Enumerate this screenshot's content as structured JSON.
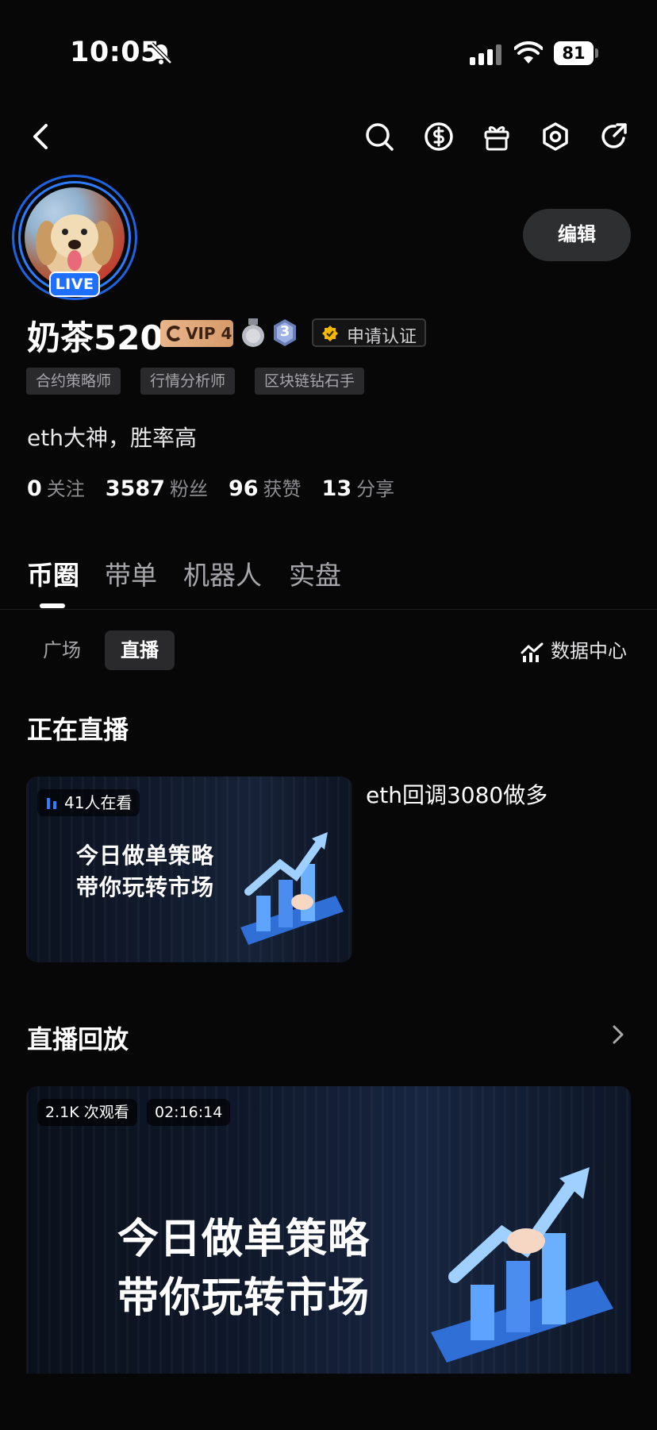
{
  "status_bar": {
    "time": "10:05",
    "battery": "81"
  },
  "profile": {
    "live_badge": "LIVE",
    "edit_label": "编辑",
    "name": "奶茶520",
    "vip_label": "VIP 4",
    "level": "3",
    "certify_label": "申请认证",
    "tags": [
      "合约策略师",
      "行情分析师",
      "区块链钻石手"
    ],
    "bio": "eth大神，胜率高",
    "stats": [
      {
        "value": "0",
        "label": "关注"
      },
      {
        "value": "3587",
        "label": "粉丝"
      },
      {
        "value": "96",
        "label": "获赞"
      },
      {
        "value": "13",
        "label": "分享"
      }
    ]
  },
  "tabs": [
    "币圈",
    "带单",
    "机器人",
    "实盘"
  ],
  "subtabs": [
    "广场",
    "直播"
  ],
  "data_center_label": "数据中心",
  "live_section": {
    "title": "正在直播",
    "viewers": "41人在看",
    "thumb_line1": "今日做单策略",
    "thumb_line2": "带你玩转市场",
    "stream_title": "eth回调3080做多"
  },
  "replay_section": {
    "title": "直播回放",
    "views": "2.1K 次观看",
    "duration": "02:16:14",
    "thumb_line1": "今日做单策略",
    "thumb_line2": "带你玩转市场"
  },
  "colors": {
    "accent_blue": "#1f6fff",
    "vip_gold": "#e0a878",
    "cert_gold": "#f5b800"
  }
}
